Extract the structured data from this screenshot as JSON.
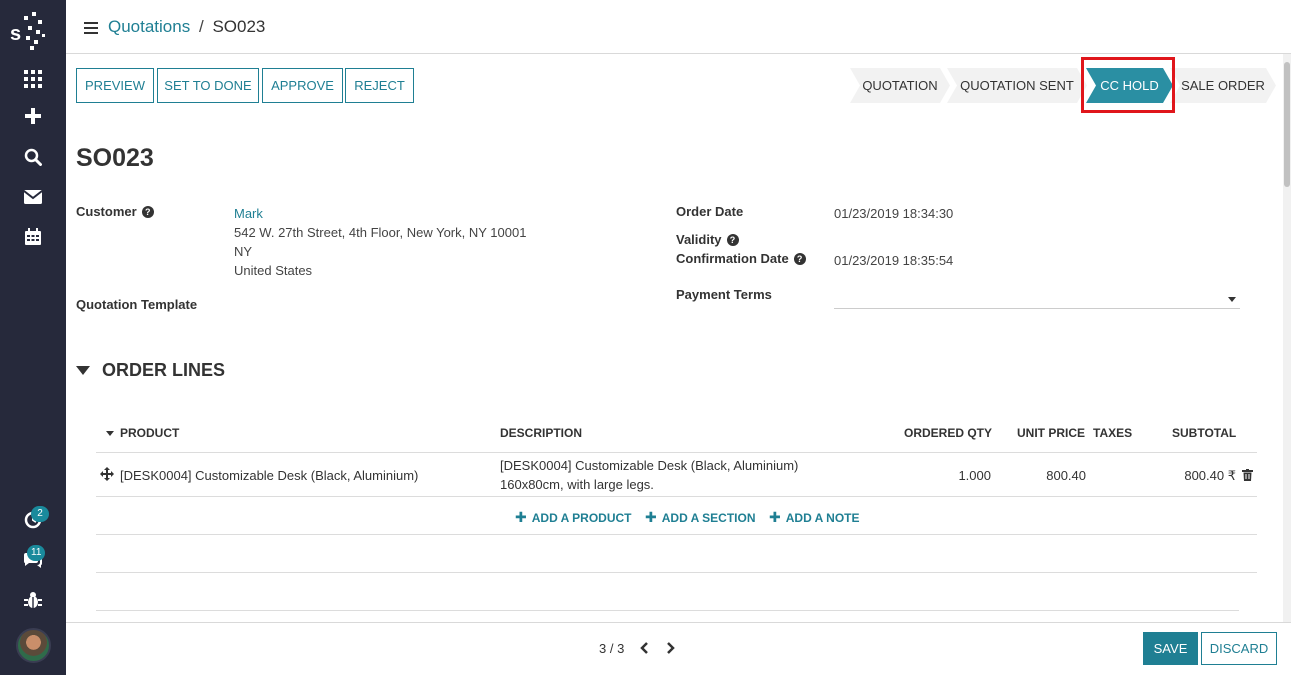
{
  "breadcrumb": {
    "parent": "Quotations",
    "separator": "/",
    "current": "SO023"
  },
  "actions": {
    "preview": "PREVIEW",
    "set_to_done": "SET TO DONE",
    "approve": "APPROVE",
    "reject": "REJECT"
  },
  "stages": [
    {
      "label": "QUOTATION",
      "active": false
    },
    {
      "label": "QUOTATION SENT",
      "active": false
    },
    {
      "label": "CC HOLD",
      "active": true
    },
    {
      "label": "SALE ORDER",
      "active": false
    }
  ],
  "record": {
    "name": "SO023",
    "customer_label": "Customer",
    "customer_name": "Mark",
    "address_line1": "542 W. 27th Street, 4th Floor, New York, NY 10001",
    "address_line2": "NY",
    "address_line3": "United States",
    "quotation_template_label": "Quotation Template",
    "order_date_label": "Order Date",
    "order_date": "01/23/2019 18:34:30",
    "validity_label": "Validity",
    "confirmation_date_label": "Confirmation Date",
    "confirmation_date": "01/23/2019 18:35:54",
    "payment_terms_label": "Payment Terms",
    "payment_terms": ""
  },
  "order_lines": {
    "section_title": "ORDER LINES",
    "columns": [
      "PRODUCT",
      "DESCRIPTION",
      "ORDERED QTY",
      "UNIT PRICE",
      "TAXES",
      "SUBTOTAL"
    ],
    "rows": [
      {
        "product": "[DESK0004] Customizable Desk (Black, Aluminium)",
        "description_line1": "[DESK0004] Customizable Desk (Black, Aluminium)",
        "description_line2": "160x80cm, with large legs.",
        "qty": "1.000",
        "unit_price": "800.40",
        "taxes": "",
        "subtotal": "800.40 ₹"
      }
    ],
    "add_product": "ADD A PRODUCT",
    "add_section": "ADD A SECTION",
    "add_note": "ADD A NOTE"
  },
  "pager": {
    "text": "3 / 3"
  },
  "footer": {
    "save": "SAVE",
    "discard": "DISCARD"
  },
  "sidebar": {
    "activity_badge": "2",
    "chat_badge": "11"
  },
  "colors": {
    "accent": "#1f7f93",
    "active_stage": "#2a8fa3",
    "sidebar": "#26293b",
    "highlight": "#e0161b"
  }
}
